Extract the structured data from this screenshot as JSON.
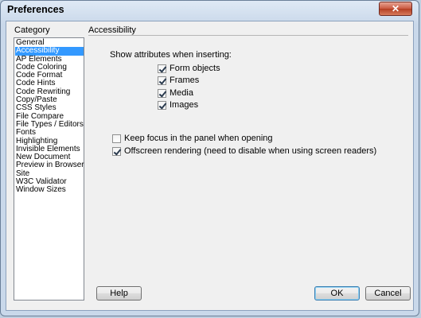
{
  "window": {
    "title": "Preferences",
    "close_glyph": "✕"
  },
  "category_label": "Category",
  "section_label": "Accessibility",
  "categories": [
    "General",
    "Accessibility",
    "AP Elements",
    "Code Coloring",
    "Code Format",
    "Code Hints",
    "Code Rewriting",
    "Copy/Paste",
    "CSS Styles",
    "File Compare",
    "File Types / Editors",
    "Fonts",
    "Highlighting",
    "Invisible Elements",
    "New Document",
    "Preview in Browser",
    "Site",
    "W3C Validator",
    "Window Sizes"
  ],
  "selected_category": "Accessibility",
  "show_attributes_label": "Show attributes when inserting:",
  "attribute_options": [
    {
      "label": "Form objects",
      "checked": true
    },
    {
      "label": "Frames",
      "checked": true
    },
    {
      "label": "Media",
      "checked": true
    },
    {
      "label": "Images",
      "checked": true
    }
  ],
  "other_options": [
    {
      "label": "Keep focus in the panel when opening",
      "checked": false
    },
    {
      "label": "Offscreen rendering (need to disable when using screen readers)",
      "checked": true
    }
  ],
  "buttons": {
    "help": "Help",
    "ok": "OK",
    "cancel": "Cancel"
  }
}
